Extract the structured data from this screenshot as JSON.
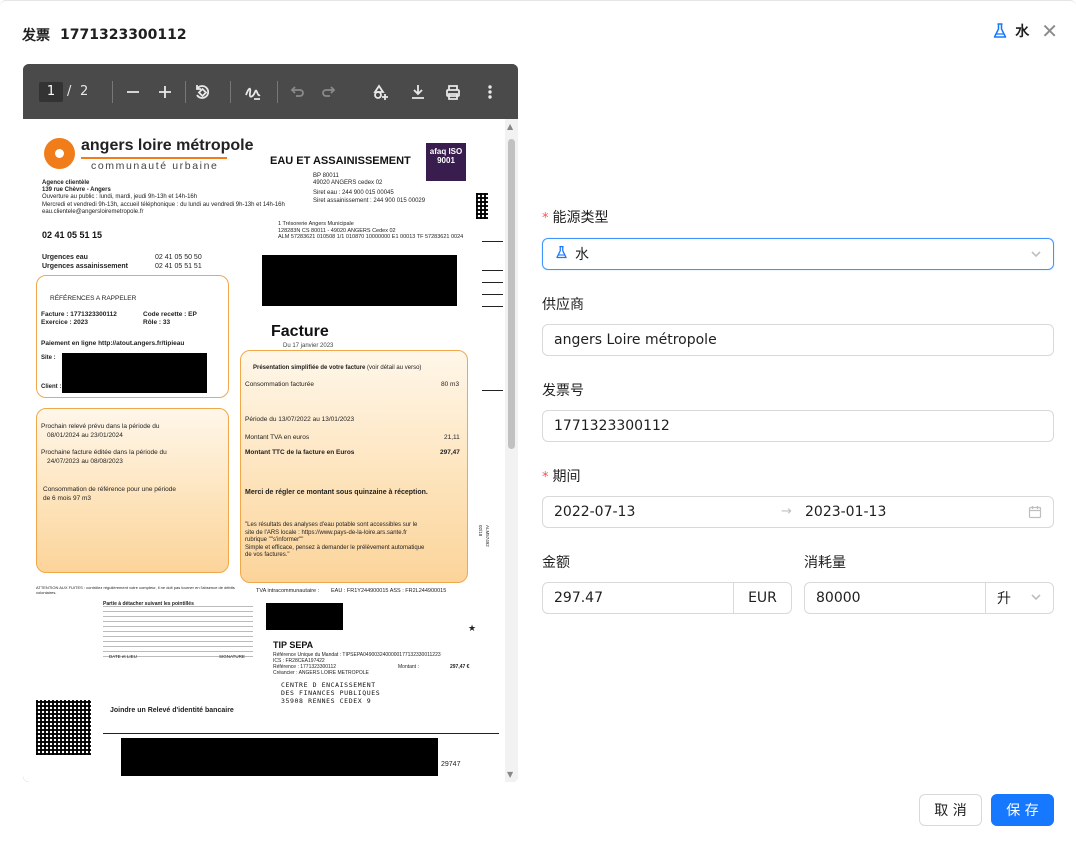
{
  "header": {
    "title_label": "发票",
    "invoice_number": "1771323300112",
    "energy_label": "水"
  },
  "viewer": {
    "current_page": "1",
    "page_separator": "/",
    "total_pages": "2",
    "document": {
      "brand": "angers loire métropole",
      "brand_sub": "communauté urbaine",
      "section_title": "EAU ET ASSAINISSEMENT",
      "afaq_text": "afaq ISO 9001",
      "bp_lines": [
        "BP 80011",
        "49020 ANGERS cedex 02",
        "Siret eau : 244 900 015 00045",
        "Siret assainissement : 244 900 015 00029"
      ],
      "agency_lines": [
        "Agence clientèle",
        "139 rue Chèvre - Angers",
        "Ouverture au public : lundi, mardi, jeudi 9h-13h et 14h-16h",
        "Mercredi et vendredi 9h-13h, accueil téléphonique : du lundi au vendredi 9h-13h et 14h-16h",
        "eau.clientele@angersloiremetropole.fr"
      ],
      "phone": "02 41 05 51 15",
      "urgent_eau_label": "Urgences eau",
      "urgent_eau_phone": "02 41 05 50 50",
      "urgent_assain_label": "Urgences assainissement",
      "urgent_assain_phone": "02 41 05 51 51",
      "treasury_lines": [
        "1      Trésorerie Angers Municipale",
        "128283N   CS 80011 - 49020 ANGERS Cedex 02",
        "ALM 57283621 010508 1/1 010870 10000000 E1 00013 TF 57283621 0024"
      ],
      "ref_title": "RÉFÉRENCES A RAPPELER",
      "ref_facture": "Facture   : 1771323300112",
      "ref_code": "Code recette   : EP",
      "ref_exercice": "Exercice  : 2023",
      "ref_role": "Rôle : 33",
      "ref_paiement": "Paiement en ligne http://atout.angers.fr/tipieau",
      "ref_site": "Site :",
      "ref_client": "Client :",
      "facture_title": "Facture",
      "facture_date": "Du 17 janvier 2023",
      "pres_title": "Présentation simplifiée de votre facture",
      "pres_title_note": "(voir détail au verso)",
      "conso_label": "Consommation facturée",
      "conso_value": "80 m3",
      "periode": "Période du  13/07/2022 au 13/01/2023",
      "tva_label": "Montant TVA en euros",
      "tva_value": "21,11",
      "ttc_label": "Montant TTC de la facture en Euros",
      "ttc_value": "297,47",
      "merci": "Merci de régler ce montant sous quinzaine à réception.",
      "ars_lines": [
        "\"Les résultats des analyses d'eau potable sont accessibles sur le",
        "site de l'ARS locale : https://www.pays-de-la-loire.ars.sante.fr",
        "rubrique \"\"s'informer\"\"",
        "Simple et efficace, pensez à demander le prélèvement automatique",
        "de vos factures.\""
      ],
      "releve_lines": [
        "Prochain relevé prévu dans la période du",
        "08/01/2024    au    23/01/2024"
      ],
      "edition_lines": [
        "Prochaine facture éditée dans la période du",
        "24/07/2023    au    08/08/2023"
      ],
      "conso_ref_lines": [
        "Consommation de référence pour une période",
        "de 6 mois 97  m3"
      ],
      "tva_intra": "TVA intracommunautaire :",
      "eau_ass": "EAU : FR1Y244900015  ASS : FR2L244900015",
      "attention": "ATTENTION AUX FUITES : contrôlez régulièrement votre compteur, il ne doit pas tourner en l'absence de débits volontaires.",
      "partie": "Partie à détacher suivant les pointillés",
      "date_lieu": "DATE et LIEU",
      "signature": "SIGNATURE",
      "tip_title": "TIP SEPA",
      "tip_lines": [
        "Référence Unique du Mandat : TIPSEPA0490032400000177132330011223",
        "ICS : FR28CEA197422",
        "Référence : 1771323300112",
        "Créancier : ANGERS LOIRE METROPOLE"
      ],
      "montant_label": "Montant :",
      "montant_value": "297,47 €",
      "centre_lines": [
        "CENTRE D ENCAISSEMENT",
        "DES FINANCES PUBLIQUES",
        "35908 RENNES CEDEX 9"
      ],
      "rib": "Joindre un Relevé d'identité bancaire",
      "footer_num": "29747",
      "side_code": "ALM57492 02/18"
    }
  },
  "form": {
    "energy_type": {
      "label": "能源类型",
      "value": "水"
    },
    "supplier": {
      "label": "供应商",
      "value": "angers Loire métropole"
    },
    "invoice_no": {
      "label": "发票号",
      "value": "1771323300112"
    },
    "period": {
      "label": "期间",
      "start": "2022-07-13",
      "end": "2023-01-13"
    },
    "amount": {
      "label": "金额",
      "value": "297.47",
      "currency": "EUR"
    },
    "consumption": {
      "label": "消耗量",
      "value": "80000",
      "unit": "升"
    }
  },
  "actions": {
    "cancel": "取 消",
    "save": "保 存"
  },
  "colors": {
    "primary": "#1677ff",
    "required": "#ff4d4f",
    "brand_orange": "#f07d1a"
  }
}
